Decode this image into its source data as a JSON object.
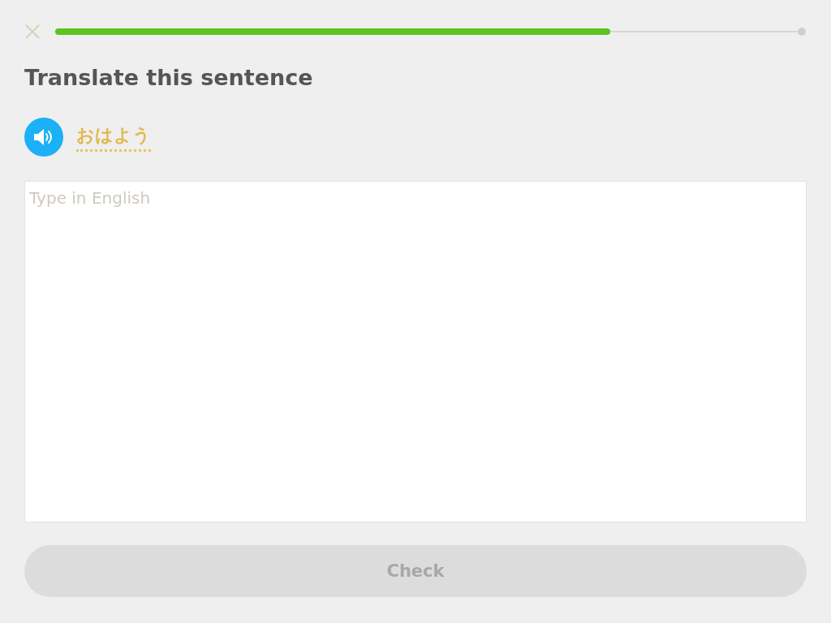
{
  "progress": {
    "level": 0.747
  },
  "title": "Translate this sentence",
  "prompt": {
    "text": "おはよう"
  },
  "answer": {
    "placeholder": "Type in English"
  },
  "check_button": {
    "label": "Check",
    "disabled": true
  }
}
